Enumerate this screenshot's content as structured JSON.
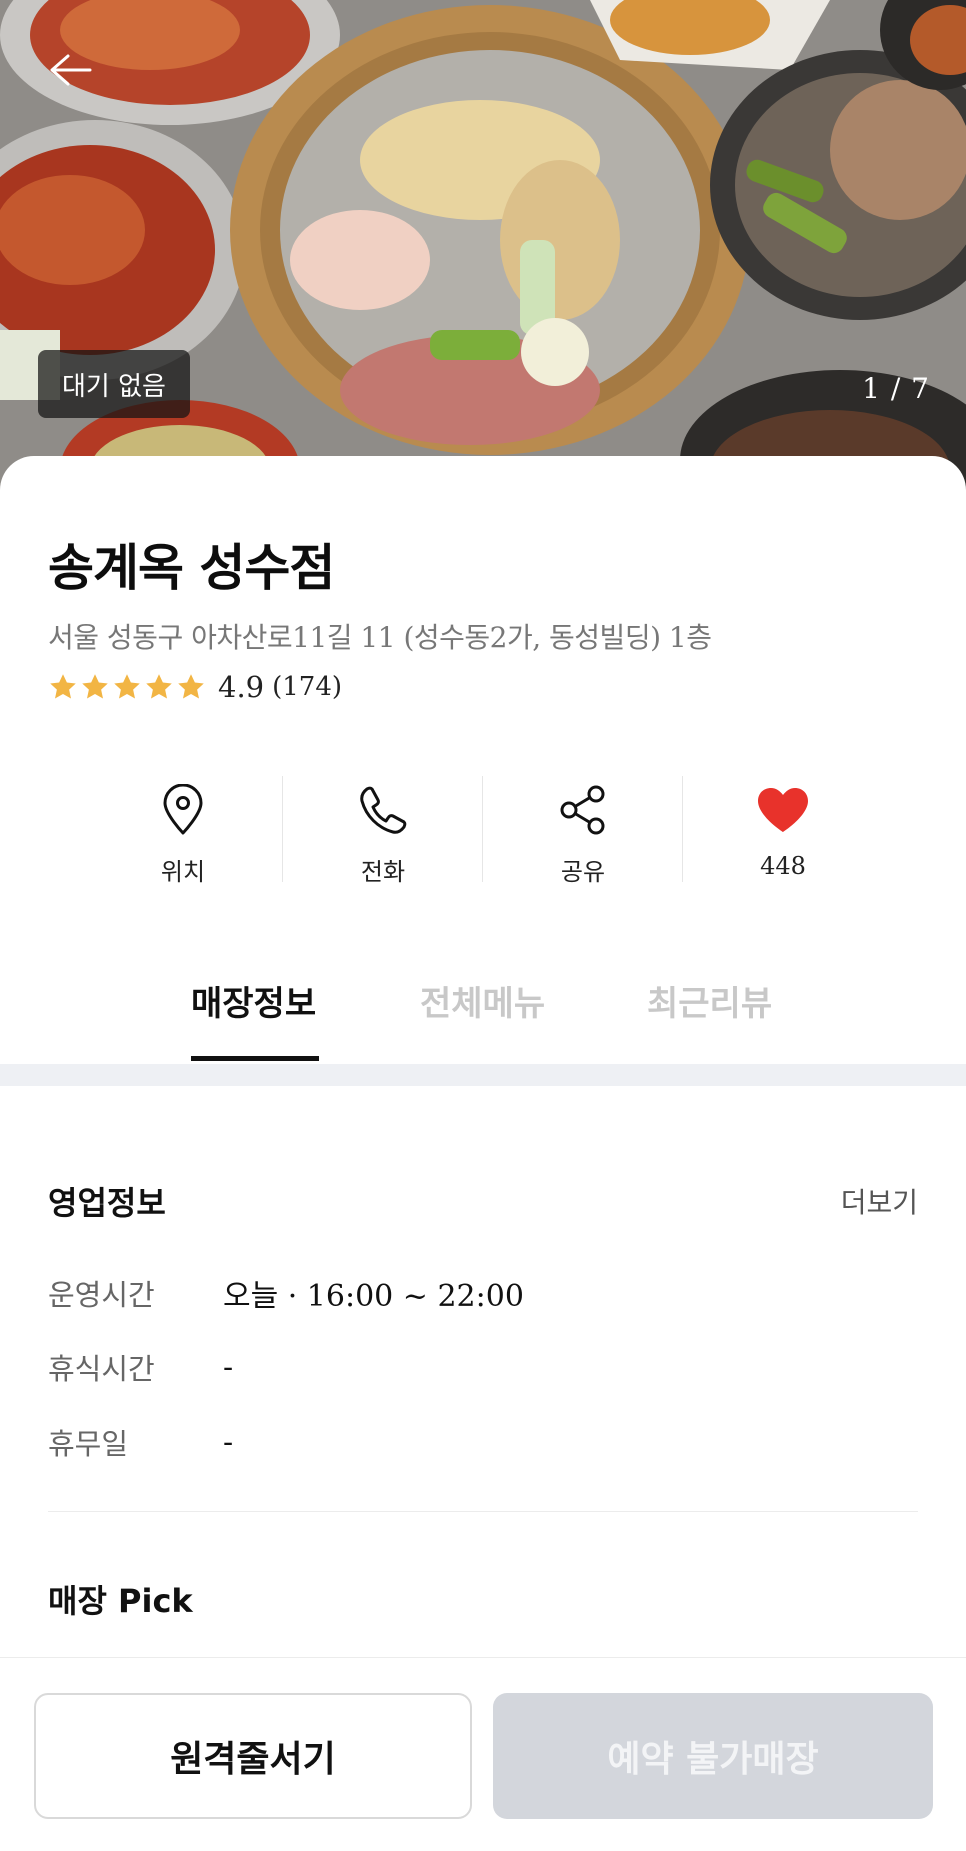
{
  "hero": {
    "wait_badge": "대기 없음",
    "page_counter": "1 / 7"
  },
  "store": {
    "name": "송계옥 성수점",
    "address": "서울 성동구 아차산로11길 11 (성수동2가, 동성빌딩) 1층",
    "rating": 4.9,
    "rating_text": "4.9",
    "review_count": "(174)",
    "stars_filled": 5
  },
  "actions": [
    {
      "label": "위치",
      "icon": "location-pin-icon"
    },
    {
      "label": "전화",
      "icon": "phone-icon"
    },
    {
      "label": "공유",
      "icon": "share-icon"
    },
    {
      "label": "448",
      "icon": "heart-icon"
    }
  ],
  "tabs": [
    {
      "label": "매장정보",
      "active": true
    },
    {
      "label": "전체메뉴",
      "active": false
    },
    {
      "label": "최근리뷰",
      "active": false
    }
  ],
  "business_info": {
    "title": "영업정보",
    "more": "더보기",
    "rows": [
      {
        "key": "운영시간",
        "value": "오늘 · 16:00 ~ 22:00"
      },
      {
        "key": "휴식시간",
        "value": "-"
      },
      {
        "key": "휴무일",
        "value": "-"
      }
    ]
  },
  "pick": {
    "title": "매장 Pick"
  },
  "bottom": {
    "queue_button": "원격줄서기",
    "reserve_button": "예약 불가매장"
  },
  "colors": {
    "star": "#f2b544",
    "heart": "#e8322b",
    "disabled_button": "#d3d6dc",
    "tab_inactive": "#c8c8c8"
  }
}
